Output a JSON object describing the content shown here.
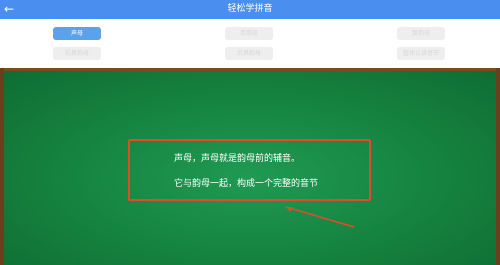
{
  "header": {
    "back_icon": "←",
    "title": "轻松学拼音"
  },
  "tabs": [
    {
      "label": "声母",
      "active": true
    },
    {
      "label": "单韵母",
      "active": false
    },
    {
      "label": "复韵母",
      "active": false
    },
    {
      "label": "前鼻韵母",
      "active": false
    },
    {
      "label": "后鼻韵母",
      "active": false
    },
    {
      "label": "整体认读音节",
      "active": false
    }
  ],
  "dialog": {
    "line1": "声母，声母就是韵母前的辅音。",
    "line2": "它与韵母一起，构成一个完整的音节"
  },
  "colors": {
    "header": "#4a8ff0",
    "active_tab": "#5aa2ec",
    "board": "#15823f",
    "highlight": "#e6482c"
  }
}
